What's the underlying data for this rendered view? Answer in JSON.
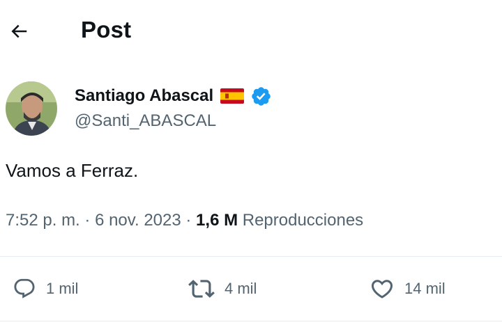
{
  "header": {
    "back_icon": "arrow-left-icon",
    "title": "Post"
  },
  "author": {
    "name": "Santiago Abascal",
    "handle": "@Santi_ABASCAL",
    "flag_icon": "spain-flag-icon",
    "verified_icon": "verified-badge-icon",
    "verified_color": "#1d9bf0"
  },
  "tweet": {
    "text": "Vamos a Ferraz."
  },
  "meta": {
    "time": "7:52 p. m.",
    "sep1": " · ",
    "date": "6 nov. 2023",
    "sep2": " · ",
    "views_count": "1,6 M",
    "views_label": " Reproducciones"
  },
  "actions": {
    "reply": {
      "icon": "reply-icon",
      "count": "1 mil"
    },
    "retweet": {
      "icon": "retweet-icon",
      "count": "4 mil"
    },
    "like": {
      "icon": "heart-icon",
      "count": "14 mil"
    }
  },
  "colors": {
    "text_primary": "#0f1419",
    "text_secondary": "#536471",
    "divider": "#e6ecf0"
  }
}
